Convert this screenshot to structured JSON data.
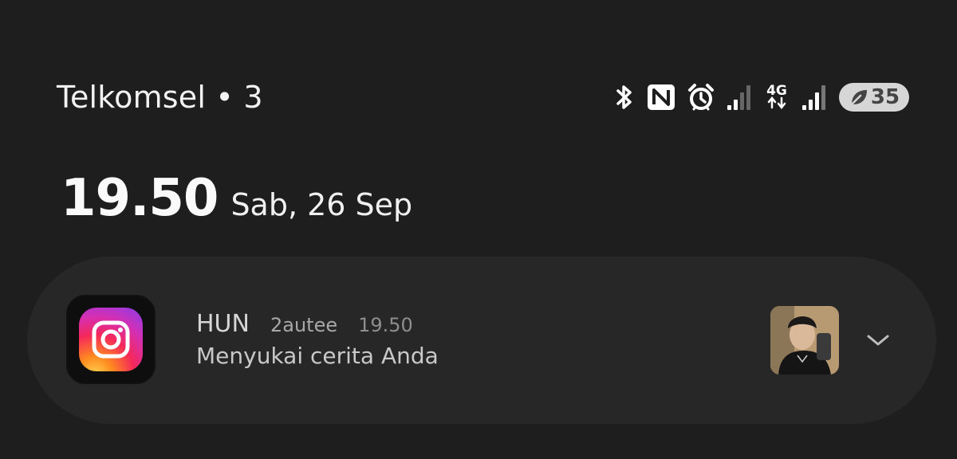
{
  "status_bar": {
    "carrier": "Telkomsel • 3",
    "network_type": "4G",
    "battery_percent": "35",
    "icons": [
      "bluetooth-icon",
      "nfc-icon",
      "alarm-icon",
      "signal-icon",
      "4g-data-icon",
      "signal-icon",
      "battery-saver-icon"
    ]
  },
  "clock": {
    "time": "19.50",
    "date": "Sab, 26 Sep"
  },
  "notification": {
    "app_icon": "instagram-icon",
    "sender": "HUN",
    "account": "2autee",
    "time": "19.50",
    "message": "Menyukai cerita Anda",
    "thumbnail": "story-thumbnail-photo",
    "expand_icon": "chevron-down-icon"
  }
}
